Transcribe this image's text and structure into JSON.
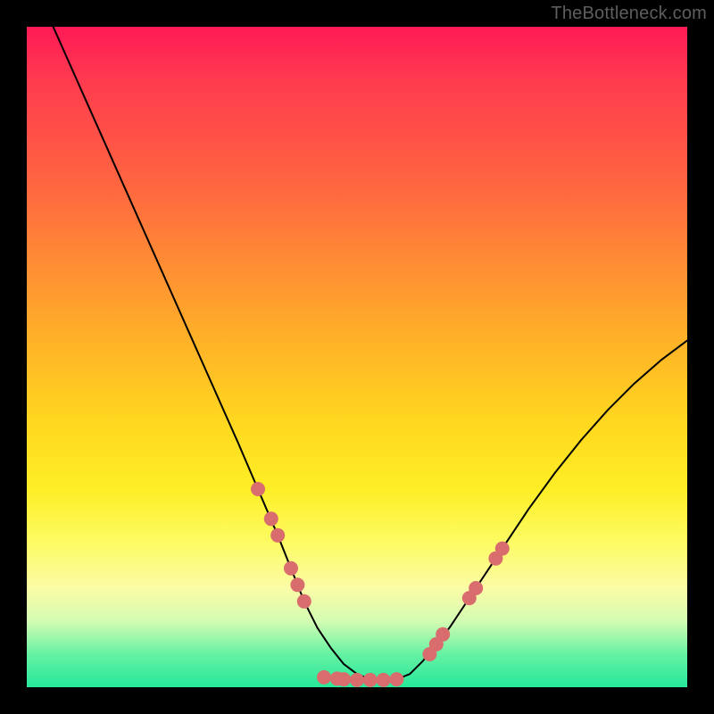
{
  "watermark": "TheBottleneck.com",
  "chart_data": {
    "type": "line",
    "title": "",
    "xlabel": "",
    "ylabel": "",
    "xlim": [
      0,
      100
    ],
    "ylim": [
      0,
      100
    ],
    "grid": false,
    "legend": false,
    "series": [
      {
        "name": "curve",
        "x": [
          4,
          8,
          12,
          16,
          20,
          24,
          28,
          32,
          35,
          38,
          40,
          42,
          44,
          46,
          48,
          50,
          52,
          54,
          56,
          58,
          60,
          64,
          68,
          72,
          76,
          80,
          84,
          88,
          92,
          96,
          100
        ],
        "y": [
          100,
          91,
          82,
          73,
          64,
          55,
          46,
          37,
          30,
          23,
          18,
          13,
          9,
          6,
          3.5,
          2,
          1.2,
          1,
          1.2,
          2,
          4,
          9,
          15,
          21,
          27,
          32.5,
          37.5,
          42,
          46,
          49.5,
          52.5
        ],
        "stroke": "#000000",
        "stroke_width": 2
      }
    ],
    "markers": {
      "name": "dots",
      "color": "#d96d6d",
      "radius": 8,
      "points": [
        {
          "x": 35,
          "y": 30
        },
        {
          "x": 37,
          "y": 25.5
        },
        {
          "x": 38,
          "y": 23
        },
        {
          "x": 40,
          "y": 18
        },
        {
          "x": 41,
          "y": 15.5
        },
        {
          "x": 42,
          "y": 13
        },
        {
          "x": 45,
          "y": 1.5
        },
        {
          "x": 47,
          "y": 1.3
        },
        {
          "x": 48,
          "y": 1.2
        },
        {
          "x": 50,
          "y": 1.1
        },
        {
          "x": 52,
          "y": 1.1
        },
        {
          "x": 54,
          "y": 1.1
        },
        {
          "x": 56,
          "y": 1.2
        },
        {
          "x": 61,
          "y": 5
        },
        {
          "x": 62,
          "y": 6.5
        },
        {
          "x": 63,
          "y": 8
        },
        {
          "x": 67,
          "y": 13.5
        },
        {
          "x": 68,
          "y": 15
        },
        {
          "x": 71,
          "y": 19.5
        },
        {
          "x": 72,
          "y": 21
        }
      ]
    }
  }
}
